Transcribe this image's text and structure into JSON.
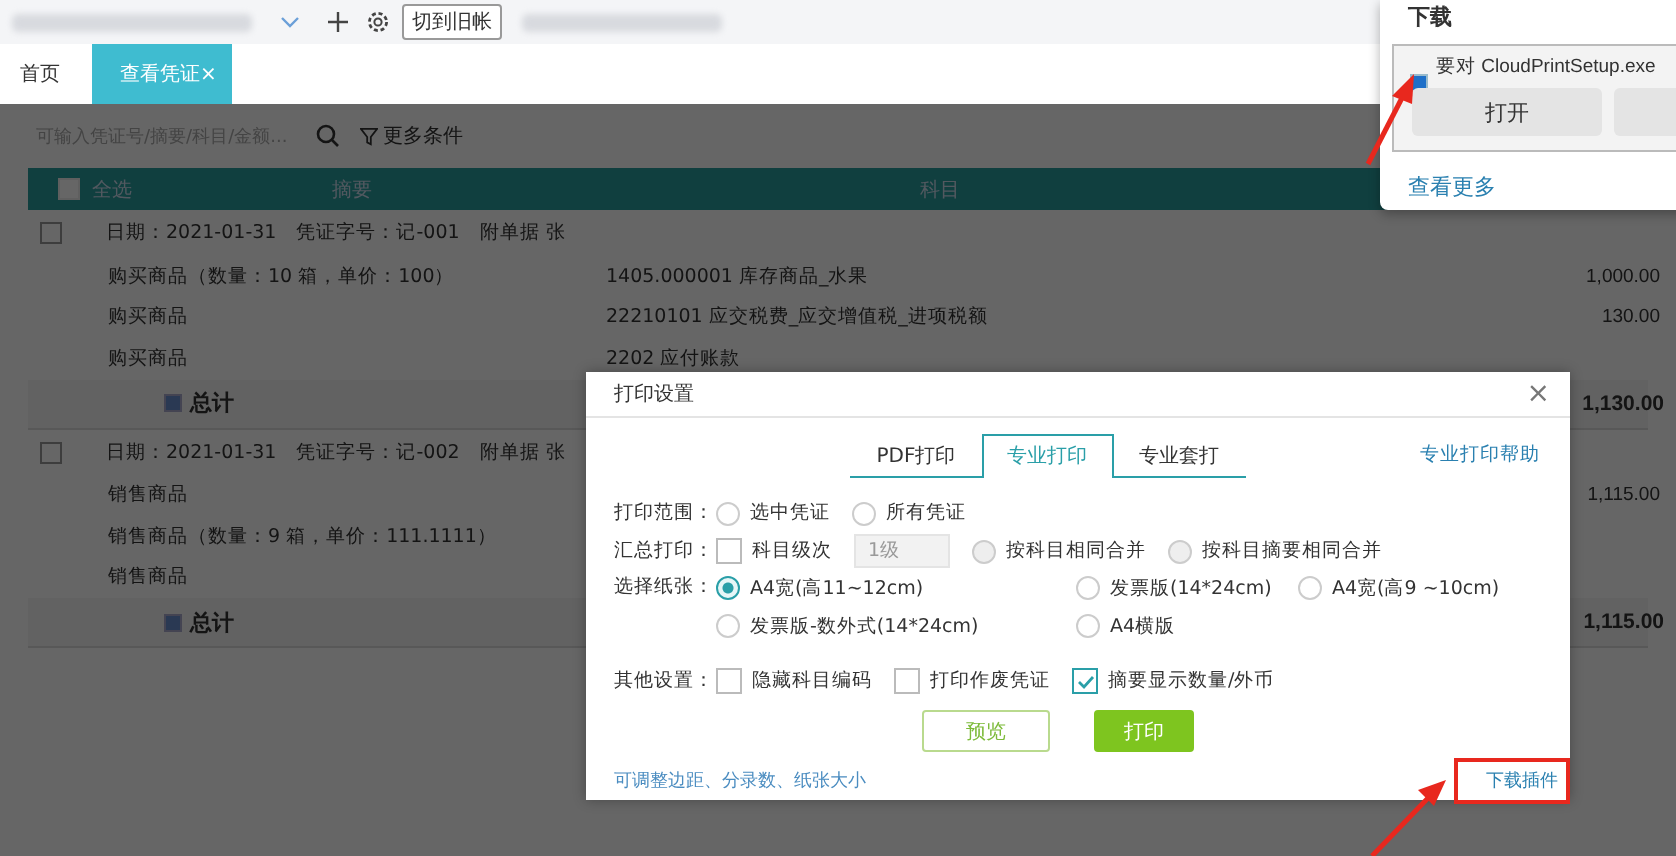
{
  "top_bar": {
    "switch_button": "切到旧帐"
  },
  "tabs": [
    {
      "label": "首页",
      "selected": false
    },
    {
      "label": "查看凭证",
      "selected": true,
      "close": "×"
    }
  ],
  "filter": {
    "placeholder": "可输入凭证号/摘要/科目/金额...",
    "more": "更多条件"
  },
  "table": {
    "select_all": {
      "label": "全选",
      "checked": false
    },
    "columns": [
      "摘要",
      "科目"
    ],
    "vouchers": [
      {
        "checked": false,
        "header": [
          "日期：2021-01-31",
          "凭证字号：记-001",
          "附单据 张"
        ],
        "lines": [
          {
            "summary": "购买商品（数量：10 箱，单价：100）",
            "account": "1405.000001 库存商品_水果",
            "amount": "1,000.00"
          },
          {
            "summary": "购买商品",
            "account": "22210101 应交税费_应交增值税_进项税额",
            "amount": "130.00"
          },
          {
            "summary": "购买商品",
            "account": "2202 应付账款"
          }
        ],
        "total_label": "总计",
        "total": "1,130.00"
      },
      {
        "checked": false,
        "header": [
          "日期：2021-01-31",
          "凭证字号：记-002",
          "附单据 张"
        ],
        "lines": [
          {
            "summary": "销售商品",
            "amount": "1,115.00"
          },
          {
            "summary": "销售商品（数量：9 箱，单价：111.1111）"
          },
          {
            "summary": "销售商品"
          }
        ],
        "total_label": "总计",
        "total": "1,115.00"
      }
    ]
  },
  "dialog": {
    "title": "打印设置",
    "close": "×",
    "tabs": [
      {
        "label": "PDF打印",
        "selected": false
      },
      {
        "label": "专业打印",
        "selected": true
      },
      {
        "label": "专业套打",
        "selected": false
      }
    ],
    "help_link": "专业打印帮助",
    "print_range": {
      "label": "打印范围：",
      "options": [
        {
          "label": "选中凭证",
          "selected": false
        },
        {
          "label": "所有凭证",
          "selected": false
        }
      ]
    },
    "summary_print": {
      "label": "汇总打印：",
      "checkbox": {
        "label": "科目级次",
        "checked": false
      },
      "level": "1级",
      "options": [
        {
          "label": "按科目相同合并",
          "selected": false,
          "disabled": true
        },
        {
          "label": "按科目摘要相同合并",
          "selected": false,
          "disabled": true
        }
      ]
    },
    "paper": {
      "label": "选择纸张：",
      "options": [
        {
          "label": "A4宽(高11~12cm)",
          "selected": true
        },
        {
          "label": "发票版(14*24cm)",
          "selected": false
        },
        {
          "label": "A4宽(高9 ~10cm)",
          "selected": false
        },
        {
          "label": "发票版-数外式(14*24cm)",
          "selected": false
        },
        {
          "label": "A4横版",
          "selected": false
        }
      ]
    },
    "other": {
      "label": "其他设置：",
      "options": [
        {
          "label": "隐藏科目编码",
          "checked": false
        },
        {
          "label": "打印作废凭证",
          "checked": false
        },
        {
          "label": "摘要显示数量/外币",
          "checked": true
        }
      ]
    },
    "buttons": [
      {
        "label": "预览",
        "kind": "secondary"
      },
      {
        "label": "打印",
        "kind": "primary"
      }
    ],
    "hint": "可调整边距、分录数、纸张大小",
    "download_link": "下载插件"
  },
  "download_panel": {
    "title": "下载",
    "message": "要对 CloudPrintSetup.exe",
    "open_button": "打开",
    "more_link": "查看更多"
  }
}
